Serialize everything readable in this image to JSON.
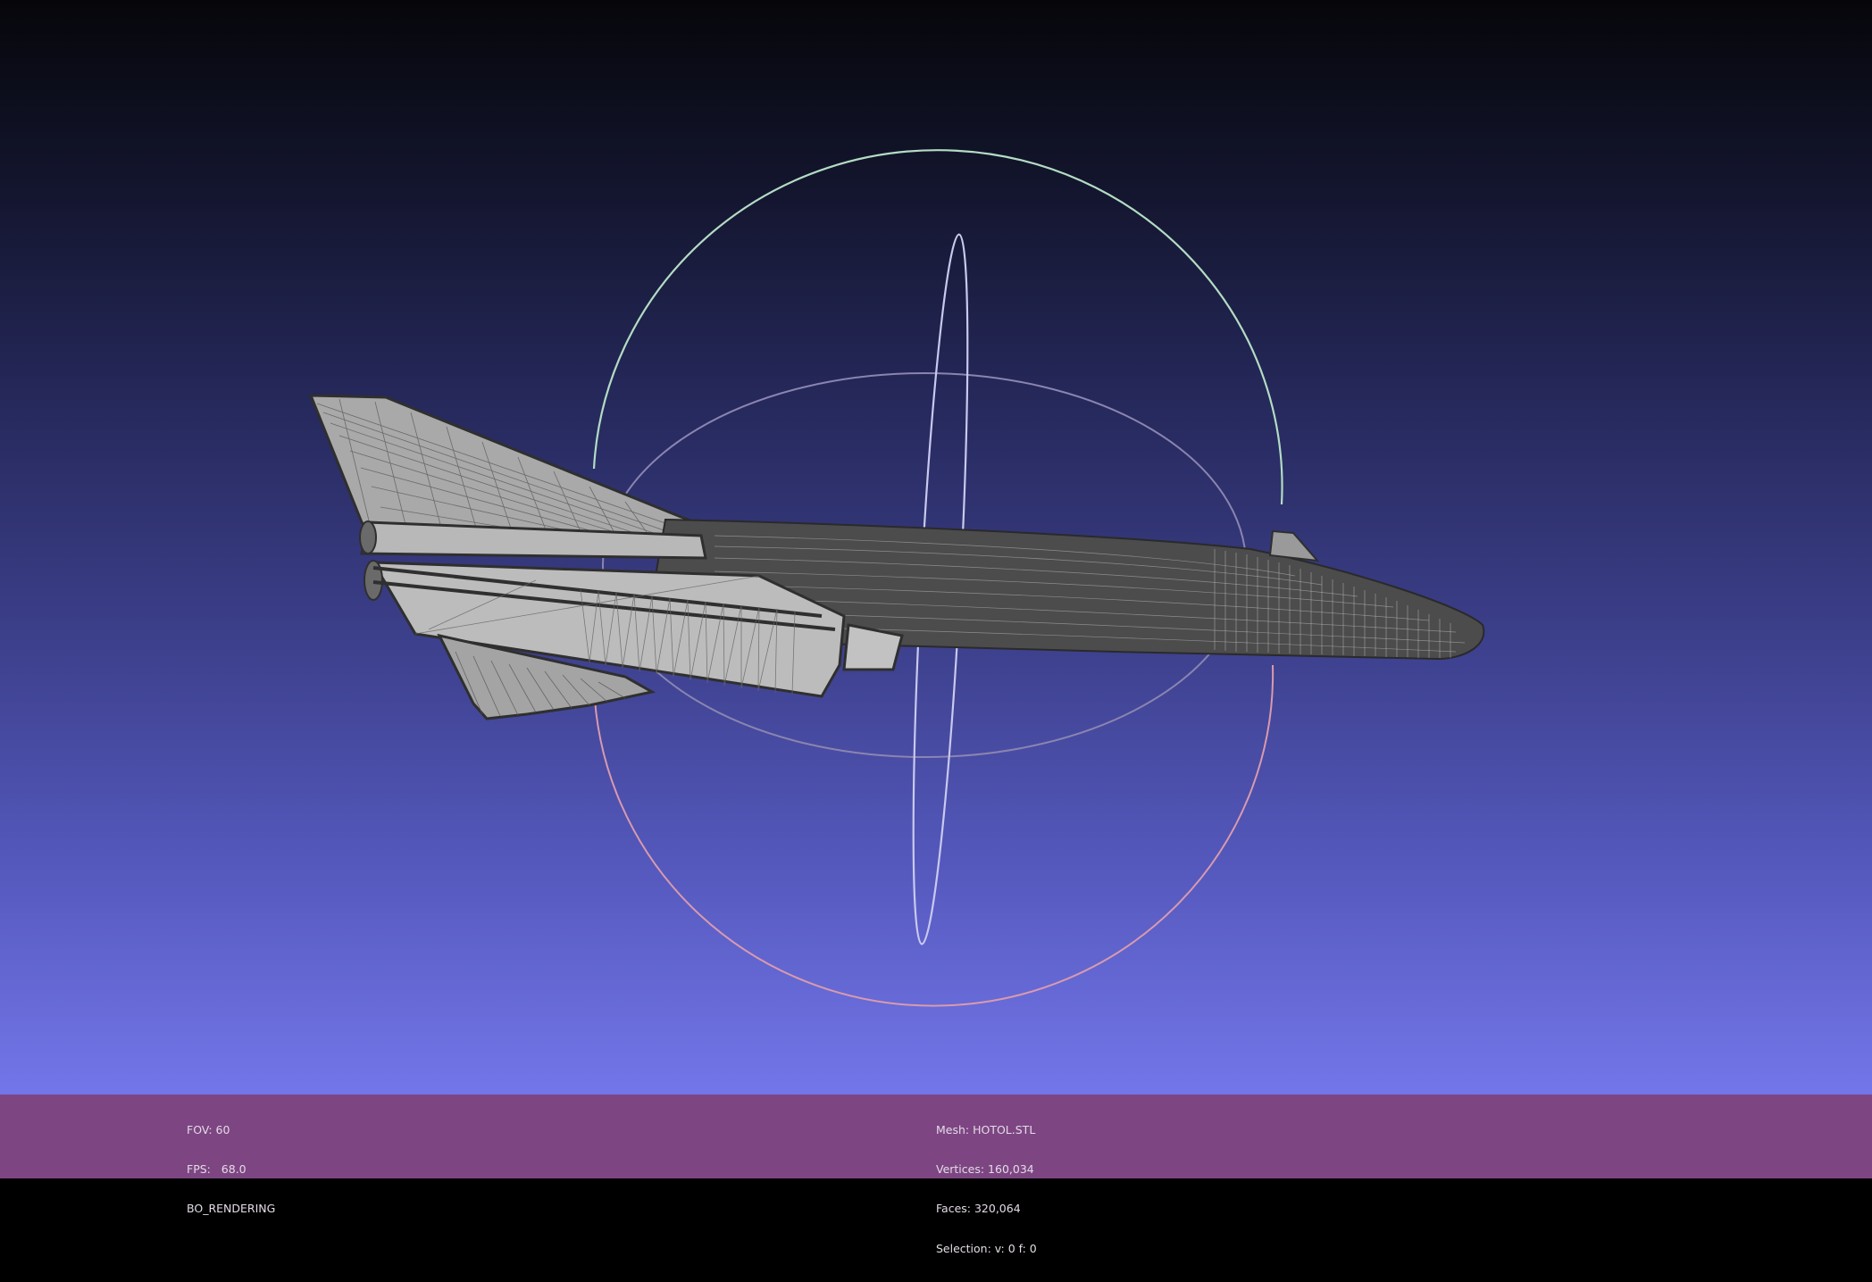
{
  "info_left": {
    "fov": "FOV: 60",
    "fps": "FPS:   68.0",
    "render_mode": "BO_RENDERING"
  },
  "info_right": {
    "mesh": "Mesh: HOTOL.STL",
    "vertices": "Vertices: 160,034",
    "faces": "Faces: 320,064",
    "selection": "Selection: v: 0 f: 0"
  },
  "colors": {
    "info_bar_background": "#7d4683",
    "gradient_top": "#06060a",
    "gradient_bottom": "#7376e9",
    "mesh_fill": "#b4b4b4",
    "mesh_edges": "#3a3a3a",
    "trackball_x": "#c7e6c9",
    "trackball_y": "#e0a2b8",
    "trackball_z": "#ccccec"
  }
}
